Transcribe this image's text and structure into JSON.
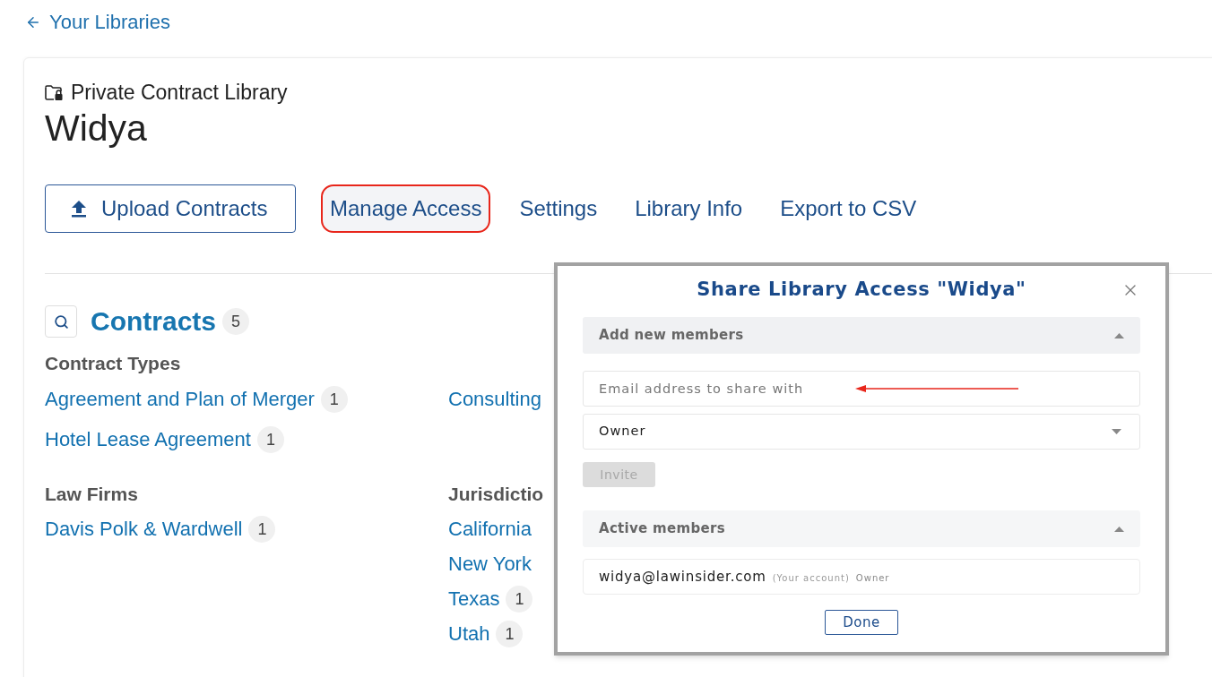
{
  "back_link": {
    "label": "Your Libraries"
  },
  "library": {
    "type_label": "Private Contract Library",
    "name": "Widya"
  },
  "actions": [
    {
      "kind": "upload",
      "label": "Upload Contracts",
      "highlighted": false
    },
    {
      "kind": "link",
      "label": "Manage Access",
      "highlighted": true
    },
    {
      "kind": "link",
      "label": "Settings",
      "highlighted": false
    },
    {
      "kind": "link",
      "label": "Library Info",
      "highlighted": false
    },
    {
      "kind": "link",
      "label": "Export to CSV",
      "highlighted": false
    }
  ],
  "contracts": {
    "title": "Contracts",
    "count": "5"
  },
  "contract_types": {
    "title": "Contract Types",
    "items": [
      {
        "label": "Agreement and Plan of Merger",
        "count": "1"
      },
      {
        "label": "Consulting"
      },
      {
        "label": "Hotel Lease Agreement",
        "count": "1"
      }
    ]
  },
  "facets": [
    {
      "title": "Law Firms",
      "items": [
        {
          "label": "Davis Polk & Wardwell",
          "count": "1"
        }
      ]
    },
    {
      "title": "Jurisdictio",
      "items": [
        {
          "label": "California"
        },
        {
          "label": "New York"
        },
        {
          "label": "Texas",
          "count": "1"
        },
        {
          "label": "Utah",
          "count": "1"
        }
      ]
    }
  ],
  "dialog": {
    "title": "Share Library Access \"Widya\"",
    "add_members": {
      "title": "Add new members",
      "expanded": true,
      "email_field": {
        "placeholder": "Email address to share with",
        "annotated": true
      },
      "role_select": {
        "value": "Owner"
      },
      "invite_button": {
        "label": "Invite",
        "disabled": true
      }
    },
    "active_members": {
      "title": "Active members",
      "expanded": true,
      "members": [
        {
          "email": "widya@lawinsider.com",
          "note": "(Your account)",
          "role": "Owner"
        }
      ]
    },
    "done_button": {
      "label": "Done"
    }
  }
}
